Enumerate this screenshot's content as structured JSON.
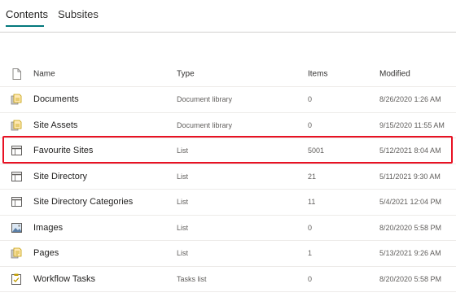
{
  "tabs": [
    {
      "label": "Contents",
      "selected": true
    },
    {
      "label": "Subsites",
      "selected": false
    }
  ],
  "accent_color": "#03787c",
  "highlight_color": "#e81123",
  "columns": {
    "name": "Name",
    "type": "Type",
    "items": "Items",
    "modified": "Modified"
  },
  "rows": [
    {
      "icon": "document-library-icon",
      "name": "Documents",
      "type": "Document library",
      "items": "0",
      "modified": "8/26/2020 1:26 AM"
    },
    {
      "icon": "document-library-icon",
      "name": "Site Assets",
      "type": "Document library",
      "items": "0",
      "modified": "9/15/2020 11:55 AM"
    },
    {
      "icon": "list-icon",
      "name": "Favourite Sites",
      "type": "List",
      "items": "5001",
      "modified": "5/12/2021 8:04 AM",
      "highlighted": true
    },
    {
      "icon": "list-icon",
      "name": "Site Directory",
      "type": "List",
      "items": "21",
      "modified": "5/11/2021 9:30 AM"
    },
    {
      "icon": "list-icon",
      "name": "Site Directory Categories",
      "type": "List",
      "items": "11",
      "modified": "5/4/2021 12:04 PM"
    },
    {
      "icon": "picture-library-icon",
      "name": "Images",
      "type": "List",
      "items": "0",
      "modified": "8/20/2020 5:58 PM"
    },
    {
      "icon": "pages-library-icon",
      "name": "Pages",
      "type": "List",
      "items": "1",
      "modified": "5/13/2021 9:26 AM"
    },
    {
      "icon": "tasks-list-icon",
      "name": "Workflow Tasks",
      "type": "Tasks list",
      "items": "0",
      "modified": "8/20/2020 5:58 PM"
    }
  ]
}
